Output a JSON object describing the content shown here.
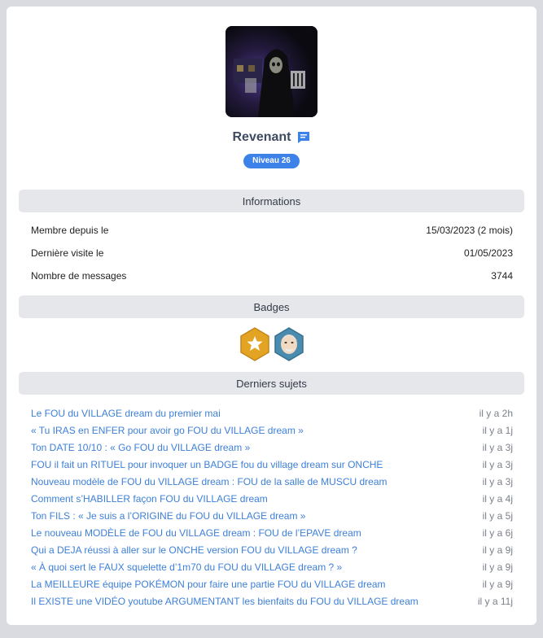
{
  "profile": {
    "username": "Revenant",
    "level": "Niveau 26"
  },
  "sections": {
    "informations": "Informations",
    "badges": "Badges",
    "latest_topics": "Derniers sujets"
  },
  "info": [
    {
      "label": "Membre depuis le",
      "value": "15/03/2023 (2 mois)"
    },
    {
      "label": "Dernière visite le",
      "value": "01/05/2023"
    },
    {
      "label": "Nombre de messages",
      "value": "3744"
    }
  ],
  "badges": [
    {
      "icon": "gold-star-hexagon-badge-icon",
      "color": "#e3a424"
    },
    {
      "icon": "old-man-face-hexagon-badge-icon",
      "color": "#4a8bb0"
    }
  ],
  "topics": [
    {
      "title": "Le FOU du VILLAGE dream du premier mai",
      "ago": "il y a 2h"
    },
    {
      "title": "« Tu IRAS en ENFER pour avoir go FOU du VILLAGE dream »",
      "ago": "il y a 1j"
    },
    {
      "title": "Ton DATE 10/10 : « Go FOU du VILLAGE dream »",
      "ago": "il y a 3j"
    },
    {
      "title": "FOU il fait un RITUEL pour invoquer un BADGE fou du village dream sur ONCHE",
      "ago": "il y a 3j"
    },
    {
      "title": "Nouveau modèle de FOU du VILLAGE dream : FOU de la salle de MUSCU dream",
      "ago": "il y a 3j"
    },
    {
      "title": "Comment s’HABILLER façon FOU du VILLAGE dream",
      "ago": "il y a 4j"
    },
    {
      "title": "Ton FILS : « Je suis a l’ORIGINE du FOU du VILLAGE dream »",
      "ago": "il y a 5j"
    },
    {
      "title": "Le nouveau MODÈLE de FOU du VILLAGE dream : FOU de l’EPAVE dream",
      "ago": "il y a 6j"
    },
    {
      "title": "Qui a DEJA réussi à aller sur le ONCHE version FOU du VILLAGE dream ?",
      "ago": "il y a 9j"
    },
    {
      "title": "« À quoi sert le FAUX squelette d’1m70 du FOU du VILLAGE dream ? »",
      "ago": "il y a 9j"
    },
    {
      "title": "La MEILLEURE équipe POKÉMON pour faire une partie FOU du VILLAGE dream",
      "ago": "il y a 9j"
    },
    {
      "title": "Il EXISTE une VIDÉO youtube ARGUMENTANT les bienfaits du FOU du VILLAGE dream",
      "ago": "il y a 11j"
    }
  ],
  "colors": {
    "accent": "#3d82e8",
    "link": "#3d7fd9",
    "section_bg": "#e6e7ea",
    "page_bg": "#d9dbe0"
  }
}
